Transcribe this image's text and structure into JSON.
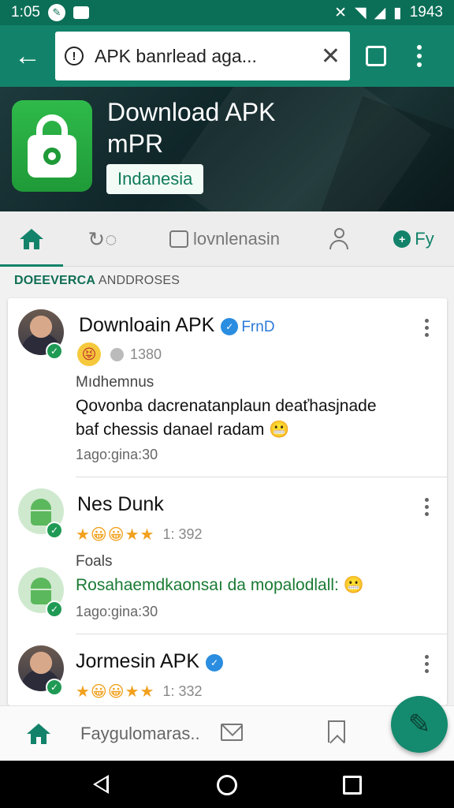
{
  "status_bar": {
    "time": "1:05",
    "battery": "1943",
    "icons": [
      "dictation-icon",
      "mail-icon",
      "mute-icon",
      "wifi-icon",
      "signal-icon",
      "battery-icon"
    ]
  },
  "toolbar": {
    "search_text": "APK banrlead aga...",
    "icons": [
      "back-arrow-icon",
      "alert-icon",
      "close-icon",
      "tabs-icon",
      "more-icon"
    ]
  },
  "hero": {
    "title_line1": "Download APK",
    "title_line2": "mPR",
    "badge": "Indanesia",
    "accent": "#12836a"
  },
  "tabs": [
    {
      "label": "",
      "icon": "home-icon",
      "active": true
    },
    {
      "label": "",
      "icon": "activity-icon",
      "active": false
    },
    {
      "label": "lovnlenasin",
      "icon": "chat-icon",
      "active": false
    },
    {
      "label": "",
      "icon": "person-icon",
      "active": false
    },
    {
      "label": "Fy",
      "icon": "download-icon",
      "active": false
    }
  ],
  "section": {
    "bold": "DOEEVERCA",
    "rest": "ANDDROSES"
  },
  "posts": [
    {
      "name": "Downloain APK",
      "tag": "FrnD",
      "verified": true,
      "meta_count": "1380",
      "label": "Mıdhemnus",
      "body_line1": "Qovonba dacrenatanplaun deaťhasjnade",
      "body_line2": "baf chessis danael radam",
      "timestamp": "1ago:gina:30"
    },
    {
      "name": "Nes Dunk",
      "stars_text": "★😀😀★★",
      "meta_count": "1: 392",
      "label": "Foals",
      "body_line1": "Rosahaemdkaonsaı da mopalodlall:",
      "timestamp": "1ago:gina:30"
    },
    {
      "name": "Jormesin APK",
      "verified": true,
      "stars_text": "★😀😀★★",
      "meta_count": "1: 332"
    }
  ],
  "bottom_nav": {
    "label": "Faygulomaras..",
    "icons": [
      "home-icon",
      "mail-icon",
      "bookmark-icon",
      "compose-icon"
    ]
  },
  "system_nav": {
    "icons": [
      "back-icon",
      "home-icon",
      "recents-icon"
    ]
  }
}
